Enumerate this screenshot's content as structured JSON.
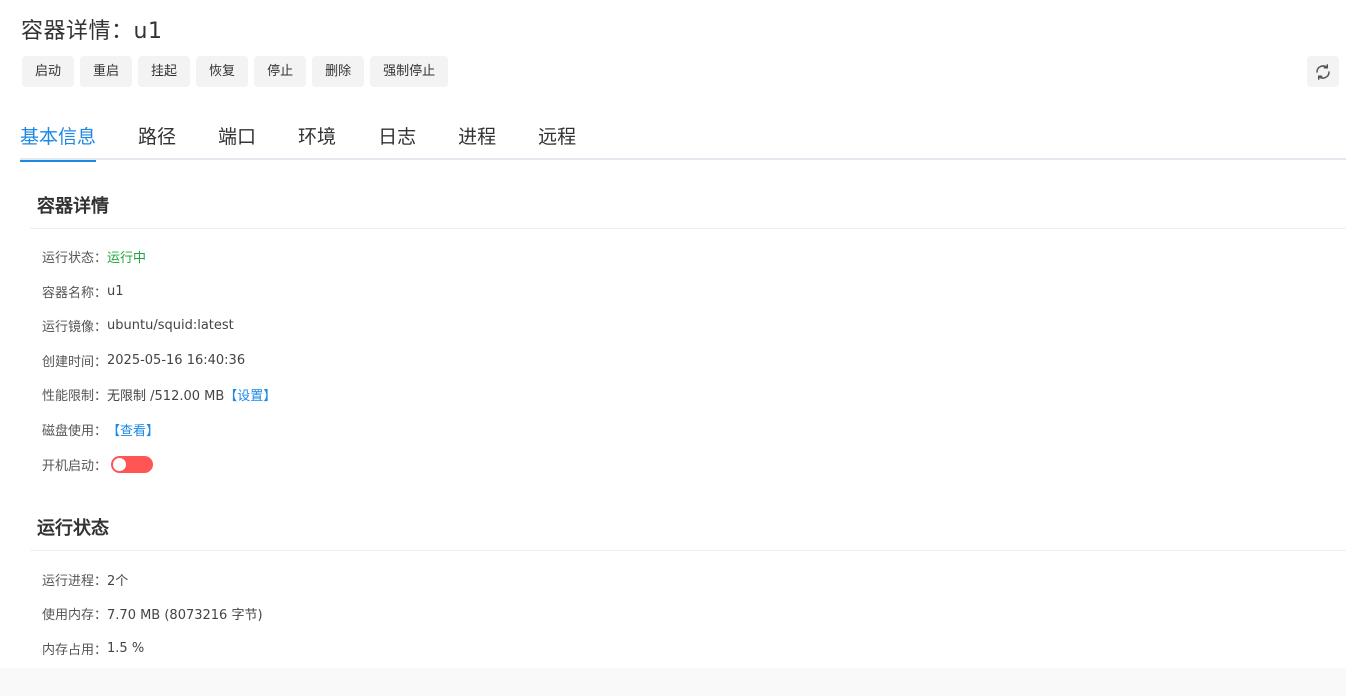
{
  "header": {
    "title": "容器详情：u1"
  },
  "toolbar": {
    "buttons": [
      "启动",
      "重启",
      "挂起",
      "恢复",
      "停止",
      "删除",
      "强制停止"
    ]
  },
  "tabs": [
    "基本信息",
    "路径",
    "端口",
    "环境",
    "日志",
    "进程",
    "远程"
  ],
  "active_tab": "基本信息",
  "details": {
    "section_title": "容器详情",
    "status_label": "运行状态：",
    "status_value": "运行中",
    "name_label": "容器名称：",
    "name_value": "u1",
    "image_label": "运行镜像：",
    "image_value": "ubuntu/squid:latest",
    "created_label": "创建时间：",
    "created_value": "2025-05-16 16:40:36",
    "limit_label": "性能限制：",
    "limit_value": "无限制 /512.00 MB",
    "limit_link": "【设置】",
    "disk_label": "磁盘使用：",
    "disk_link": "【查看】",
    "autostart_label": "开机启动："
  },
  "runtime": {
    "section_title": "运行状态",
    "procs_label": "运行进程：",
    "procs_value": "2个",
    "mem_label": "使用内存：",
    "mem_value": "7.70 MB (8073216 字节)",
    "memuse_label": "内存占用：",
    "memuse_value": "1.5 %"
  },
  "colors": {
    "accent": "#1e88e5",
    "running": "#20a53a",
    "toggle_off": "#ff5555"
  },
  "autostart_enabled": false
}
